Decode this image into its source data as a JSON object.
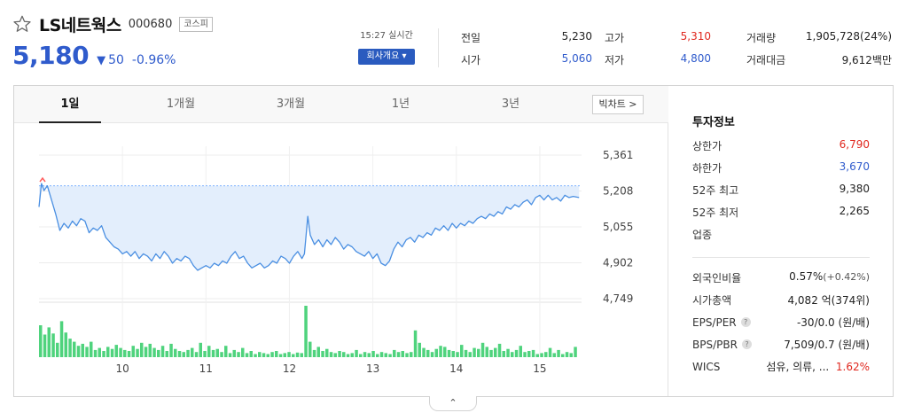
{
  "stock": {
    "name": "LS네트웍스",
    "code": "000680",
    "market": "코스피",
    "price": "5,180",
    "change_arrow": "▼",
    "change": "50",
    "change_pct": "-0.96%"
  },
  "realtime": {
    "time": "15:27 실시간",
    "company_btn": "회사개요 ▾"
  },
  "quotes": [
    {
      "label": "전일",
      "value": "5,230",
      "color": "#222222"
    },
    {
      "label": "시가",
      "value": "5,060",
      "color": "#2f5bcc"
    },
    {
      "label": "고가",
      "value": "5,310",
      "color": "#e0281f"
    },
    {
      "label": "저가",
      "value": "4,800",
      "color": "#2f5bcc"
    },
    {
      "label": "거래량",
      "value": "1,905,728(24%)",
      "color": "#222222"
    },
    {
      "label": "거래대금",
      "value": "9,612백만",
      "color": "#222222"
    }
  ],
  "tabs": [
    {
      "label": "1일",
      "active": true
    },
    {
      "label": "1개월",
      "active": false
    },
    {
      "label": "3개월",
      "active": false
    },
    {
      "label": "1년",
      "active": false
    },
    {
      "label": "3년",
      "active": false
    }
  ],
  "big_chart_label": "빅차트 >",
  "chart_data": {
    "type": "area",
    "y_ticks": [
      "5,361",
      "5,208",
      "5,055",
      "4,902",
      "4,749"
    ],
    "y_tick_values": [
      5361,
      5208,
      5055,
      4902,
      4749
    ],
    "ylim": [
      4749,
      5361
    ],
    "previous_close": 5230,
    "x_ticks": [
      "10",
      "11",
      "12",
      "13",
      "14",
      "15"
    ],
    "x_tick_hours": [
      10,
      11,
      12,
      13,
      14,
      15
    ],
    "x_range_hours": [
      9.0,
      15.5
    ],
    "price_series": [
      {
        "t": 9.0,
        "v": 5140
      },
      {
        "t": 9.03,
        "v": 5240
      },
      {
        "t": 9.06,
        "v": 5210
      },
      {
        "t": 9.1,
        "v": 5230
      },
      {
        "t": 9.15,
        "v": 5170
      },
      {
        "t": 9.2,
        "v": 5110
      },
      {
        "t": 9.25,
        "v": 5040
      },
      {
        "t": 9.3,
        "v": 5070
      },
      {
        "t": 9.35,
        "v": 5050
      },
      {
        "t": 9.4,
        "v": 5080
      },
      {
        "t": 9.45,
        "v": 5060
      },
      {
        "t": 9.5,
        "v": 5090
      },
      {
        "t": 9.55,
        "v": 5080
      },
      {
        "t": 9.6,
        "v": 5030
      },
      {
        "t": 9.65,
        "v": 5050
      },
      {
        "t": 9.7,
        "v": 5040
      },
      {
        "t": 9.75,
        "v": 5060
      },
      {
        "t": 9.8,
        "v": 5010
      },
      {
        "t": 9.85,
        "v": 4990
      },
      {
        "t": 9.9,
        "v": 4970
      },
      {
        "t": 9.95,
        "v": 4960
      },
      {
        "t": 10.0,
        "v": 4940
      },
      {
        "t": 10.05,
        "v": 4950
      },
      {
        "t": 10.1,
        "v": 4930
      },
      {
        "t": 10.15,
        "v": 4950
      },
      {
        "t": 10.2,
        "v": 4920
      },
      {
        "t": 10.25,
        "v": 4940
      },
      {
        "t": 10.3,
        "v": 4930
      },
      {
        "t": 10.35,
        "v": 4910
      },
      {
        "t": 10.4,
        "v": 4940
      },
      {
        "t": 10.45,
        "v": 4920
      },
      {
        "t": 10.5,
        "v": 4950
      },
      {
        "t": 10.55,
        "v": 4930
      },
      {
        "t": 10.6,
        "v": 4900
      },
      {
        "t": 10.65,
        "v": 4920
      },
      {
        "t": 10.7,
        "v": 4910
      },
      {
        "t": 10.75,
        "v": 4930
      },
      {
        "t": 10.8,
        "v": 4920
      },
      {
        "t": 10.85,
        "v": 4890
      },
      {
        "t": 10.9,
        "v": 4870
      },
      {
        "t": 10.95,
        "v": 4880
      },
      {
        "t": 11.0,
        "v": 4890
      },
      {
        "t": 11.05,
        "v": 4880
      },
      {
        "t": 11.1,
        "v": 4900
      },
      {
        "t": 11.15,
        "v": 4890
      },
      {
        "t": 11.2,
        "v": 4910
      },
      {
        "t": 11.25,
        "v": 4900
      },
      {
        "t": 11.3,
        "v": 4930
      },
      {
        "t": 11.35,
        "v": 4950
      },
      {
        "t": 11.4,
        "v": 4920
      },
      {
        "t": 11.45,
        "v": 4930
      },
      {
        "t": 11.5,
        "v": 4900
      },
      {
        "t": 11.55,
        "v": 4880
      },
      {
        "t": 11.6,
        "v": 4890
      },
      {
        "t": 11.65,
        "v": 4900
      },
      {
        "t": 11.7,
        "v": 4880
      },
      {
        "t": 11.75,
        "v": 4890
      },
      {
        "t": 11.8,
        "v": 4910
      },
      {
        "t": 11.85,
        "v": 4900
      },
      {
        "t": 11.9,
        "v": 4930
      },
      {
        "t": 11.95,
        "v": 4920
      },
      {
        "t": 12.0,
        "v": 4900
      },
      {
        "t": 12.05,
        "v": 4930
      },
      {
        "t": 12.1,
        "v": 4950
      },
      {
        "t": 12.15,
        "v": 4920
      },
      {
        "t": 12.18,
        "v": 4940
      },
      {
        "t": 12.22,
        "v": 5100
      },
      {
        "t": 12.25,
        "v": 5020
      },
      {
        "t": 12.3,
        "v": 4980
      },
      {
        "t": 12.35,
        "v": 5000
      },
      {
        "t": 12.4,
        "v": 4970
      },
      {
        "t": 12.45,
        "v": 5000
      },
      {
        "t": 12.5,
        "v": 4980
      },
      {
        "t": 12.55,
        "v": 5010
      },
      {
        "t": 12.6,
        "v": 4990
      },
      {
        "t": 12.65,
        "v": 4960
      },
      {
        "t": 12.7,
        "v": 4980
      },
      {
        "t": 12.75,
        "v": 4970
      },
      {
        "t": 12.8,
        "v": 4950
      },
      {
        "t": 12.85,
        "v": 4940
      },
      {
        "t": 12.9,
        "v": 4930
      },
      {
        "t": 12.95,
        "v": 4950
      },
      {
        "t": 13.0,
        "v": 4920
      },
      {
        "t": 13.05,
        "v": 4940
      },
      {
        "t": 13.1,
        "v": 4900
      },
      {
        "t": 13.15,
        "v": 4890
      },
      {
        "t": 13.2,
        "v": 4910
      },
      {
        "t": 13.25,
        "v": 4960
      },
      {
        "t": 13.3,
        "v": 4990
      },
      {
        "t": 13.35,
        "v": 4970
      },
      {
        "t": 13.4,
        "v": 5000
      },
      {
        "t": 13.45,
        "v": 5010
      },
      {
        "t": 13.5,
        "v": 4990
      },
      {
        "t": 13.55,
        "v": 5020
      },
      {
        "t": 13.6,
        "v": 5010
      },
      {
        "t": 13.65,
        "v": 5030
      },
      {
        "t": 13.7,
        "v": 5020
      },
      {
        "t": 13.75,
        "v": 5050
      },
      {
        "t": 13.8,
        "v": 5040
      },
      {
        "t": 13.85,
        "v": 5060
      },
      {
        "t": 13.9,
        "v": 5040
      },
      {
        "t": 13.95,
        "v": 5070
      },
      {
        "t": 14.0,
        "v": 5050
      },
      {
        "t": 14.05,
        "v": 5070
      },
      {
        "t": 14.1,
        "v": 5060
      },
      {
        "t": 14.15,
        "v": 5080
      },
      {
        "t": 14.2,
        "v": 5070
      },
      {
        "t": 14.25,
        "v": 5090
      },
      {
        "t": 14.3,
        "v": 5100
      },
      {
        "t": 14.35,
        "v": 5090
      },
      {
        "t": 14.4,
        "v": 5110
      },
      {
        "t": 14.45,
        "v": 5100
      },
      {
        "t": 14.5,
        "v": 5120
      },
      {
        "t": 14.55,
        "v": 5110
      },
      {
        "t": 14.6,
        "v": 5140
      },
      {
        "t": 14.65,
        "v": 5130
      },
      {
        "t": 14.7,
        "v": 5150
      },
      {
        "t": 14.75,
        "v": 5140
      },
      {
        "t": 14.8,
        "v": 5160
      },
      {
        "t": 14.85,
        "v": 5170
      },
      {
        "t": 14.9,
        "v": 5150
      },
      {
        "t": 14.95,
        "v": 5180
      },
      {
        "t": 15.0,
        "v": 5190
      },
      {
        "t": 15.05,
        "v": 5170
      },
      {
        "t": 15.1,
        "v": 5190
      },
      {
        "t": 15.15,
        "v": 5170
      },
      {
        "t": 15.2,
        "v": 5180
      },
      {
        "t": 15.25,
        "v": 5165
      },
      {
        "t": 15.3,
        "v": 5190
      },
      {
        "t": 15.35,
        "v": 5180
      },
      {
        "t": 15.4,
        "v": 5185
      },
      {
        "t": 15.47,
        "v": 5180
      }
    ],
    "volume_series": [
      62,
      44,
      58,
      46,
      28,
      70,
      48,
      36,
      30,
      22,
      26,
      20,
      30,
      14,
      18,
      12,
      20,
      16,
      24,
      18,
      14,
      12,
      22,
      16,
      28,
      20,
      26,
      18,
      14,
      22,
      12,
      26,
      16,
      12,
      10,
      14,
      18,
      10,
      28,
      12,
      22,
      14,
      16,
      10,
      22,
      8,
      14,
      10,
      18,
      8,
      12,
      6,
      10,
      8,
      6,
      10,
      12,
      6,
      8,
      10,
      6,
      9,
      8,
      100,
      30,
      14,
      20,
      12,
      16,
      10,
      8,
      12,
      10,
      6,
      8,
      14,
      6,
      10,
      8,
      12,
      6,
      10,
      8,
      6,
      14,
      10,
      12,
      8,
      10,
      52,
      28,
      18,
      14,
      10,
      16,
      22,
      20,
      14,
      12,
      10,
      24,
      14,
      10,
      18,
      16,
      28,
      20,
      14,
      18,
      26,
      12,
      16,
      10,
      14,
      22,
      10,
      12,
      14,
      6,
      8,
      10,
      18,
      8,
      14,
      6,
      10,
      8,
      20
    ],
    "volume_ylim": [
      0,
      100
    ],
    "xlabel": "",
    "ylabel": "",
    "title": "",
    "colors": {
      "line": "#4a8fe2",
      "fill": "#e3eefc",
      "volume": "#4fd37d",
      "ref_line": "#7fb3ff",
      "start_marker": "#ff5b5b"
    }
  },
  "invest_info": {
    "title": "투자정보",
    "rows1": [
      {
        "label": "상한가",
        "value": "6,790",
        "color": "red"
      },
      {
        "label": "하한가",
        "value": "3,670",
        "color": "blue"
      },
      {
        "label": "52주 최고",
        "value": "9,380",
        "color": "dark"
      },
      {
        "label": "52주 최저",
        "value": "2,265",
        "color": "dark"
      },
      {
        "label": "업종",
        "value": "",
        "color": "dark"
      }
    ],
    "foreign_label": "외국인비율",
    "foreign_value": "0.57%",
    "foreign_change": "(+0.42%)",
    "mcap_label": "시가총액",
    "mcap_value": "4,082 억(374위)",
    "eps_label": "EPS/PER",
    "eps_value": "-30/0.0 (원/배)",
    "bps_label": "BPS/PBR",
    "bps_value": "7,509/0.7 (원/배)",
    "wics_label": "WICS",
    "wics_value": "섬유, 의류, ...",
    "wics_change": "1.62%",
    "qmark": "?"
  },
  "collapse_icon": "⌃"
}
